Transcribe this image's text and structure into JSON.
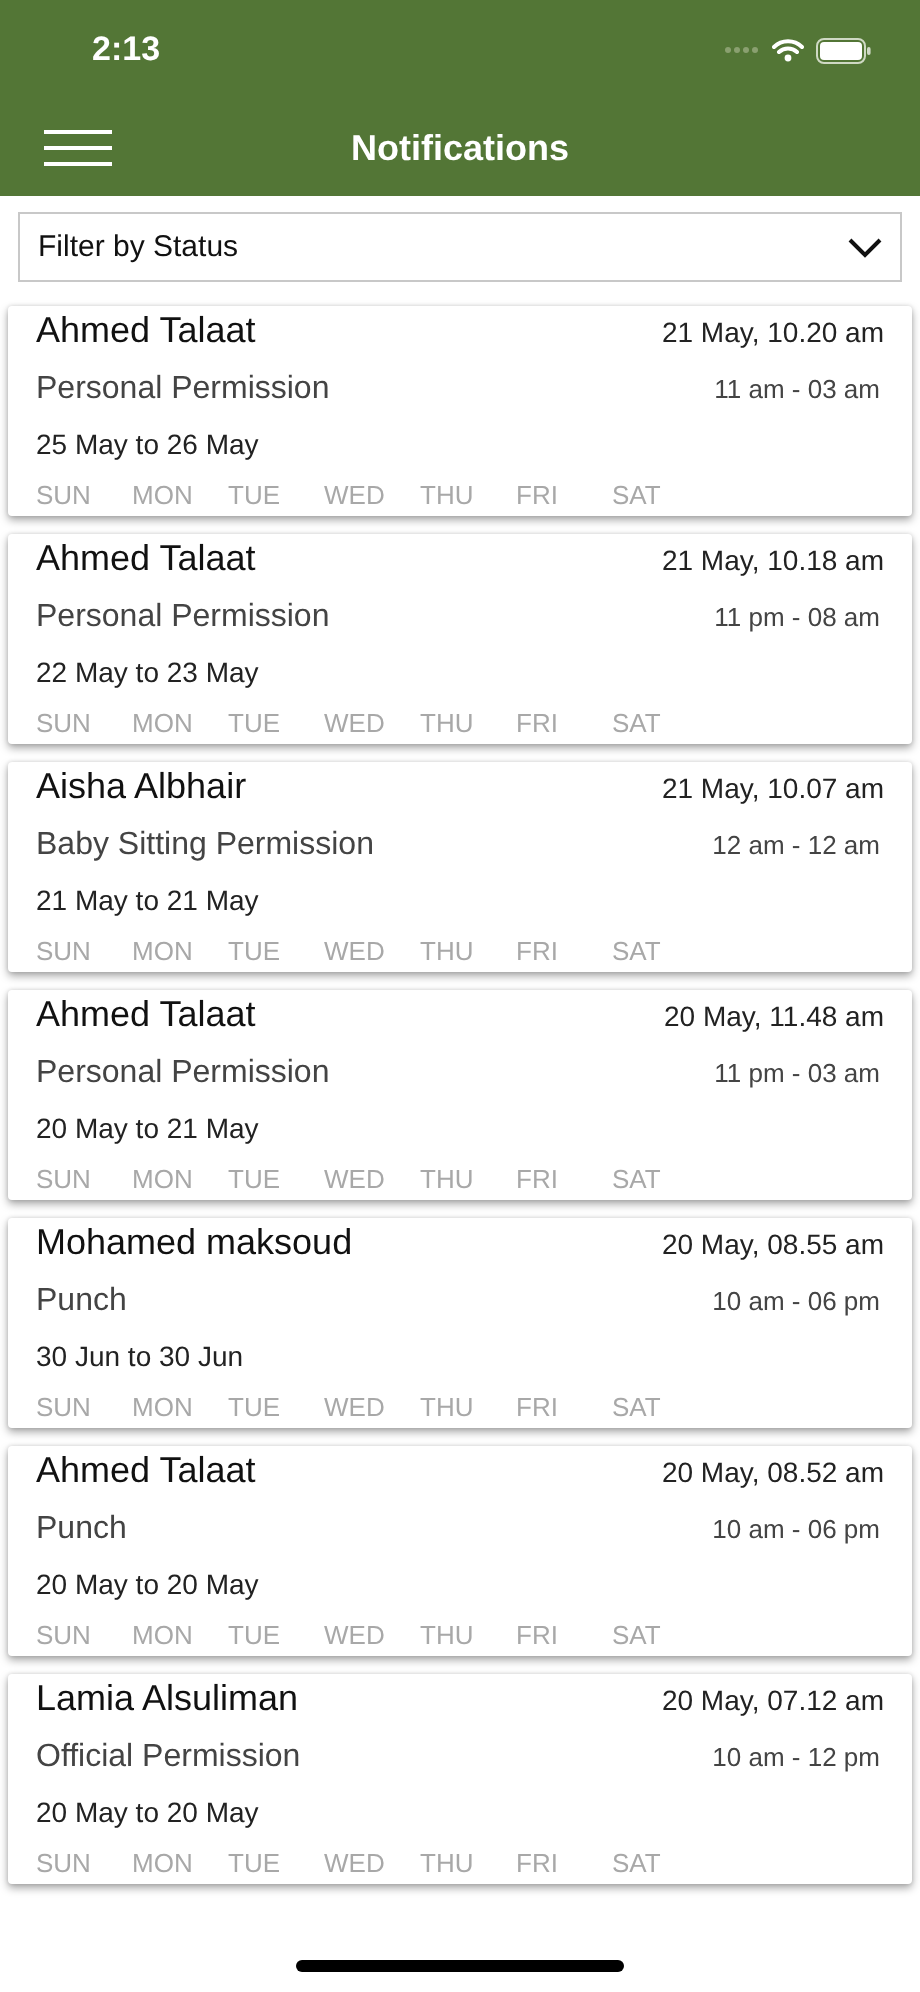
{
  "status_bar": {
    "time": "2:13"
  },
  "header": {
    "title": "Notifications"
  },
  "filter": {
    "placeholder": "Filter by Status"
  },
  "notifications": [
    {
      "name": "Ahmed Talaat",
      "timestamp": "21 May, 10.20 am",
      "type": "Personal Permission",
      "hours": "11 am - 03 am",
      "dates": "25 May to 26 May",
      "days": [
        "SUN",
        "MON",
        "TUE",
        "WED",
        "THU",
        "FRI",
        "SAT"
      ]
    },
    {
      "name": "Ahmed Talaat",
      "timestamp": "21 May, 10.18 am",
      "type": "Personal Permission",
      "hours": "11 pm - 08 am",
      "dates": "22 May to 23 May",
      "days": [
        "SUN",
        "MON",
        "TUE",
        "WED",
        "THU",
        "FRI",
        "SAT"
      ]
    },
    {
      "name": "Aisha Albhair",
      "timestamp": "21 May, 10.07 am",
      "type": "Baby Sitting Permission",
      "hours": "12 am - 12 am",
      "dates": "21 May to 21 May",
      "days": [
        "SUN",
        "MON",
        "TUE",
        "WED",
        "THU",
        "FRI",
        "SAT"
      ]
    },
    {
      "name": "Ahmed Talaat",
      "timestamp": "20 May, 11.48 am",
      "type": "Personal Permission",
      "hours": "11 pm - 03 am",
      "dates": "20 May to 21 May",
      "days": [
        "SUN",
        "MON",
        "TUE",
        "WED",
        "THU",
        "FRI",
        "SAT"
      ]
    },
    {
      "name": "Mohamed maksoud",
      "timestamp": "20 May, 08.55 am",
      "type": "Punch",
      "hours": "10 am - 06 pm",
      "dates": "30 Jun to 30 Jun",
      "days": [
        "SUN",
        "MON",
        "TUE",
        "WED",
        "THU",
        "FRI",
        "SAT"
      ]
    },
    {
      "name": "Ahmed Talaat",
      "timestamp": "20 May, 08.52 am",
      "type": "Punch",
      "hours": "10 am - 06 pm",
      "dates": "20 May to 20 May",
      "days": [
        "SUN",
        "MON",
        "TUE",
        "WED",
        "THU",
        "FRI",
        "SAT"
      ]
    },
    {
      "name": "Lamia Alsuliman",
      "timestamp": "20 May, 07.12 am",
      "type": "Official Permission",
      "hours": "10 am - 12 pm",
      "dates": "20 May to 20 May",
      "days": [
        "SUN",
        "MON",
        "TUE",
        "WED",
        "THU",
        "FRI",
        "SAT"
      ]
    }
  ]
}
